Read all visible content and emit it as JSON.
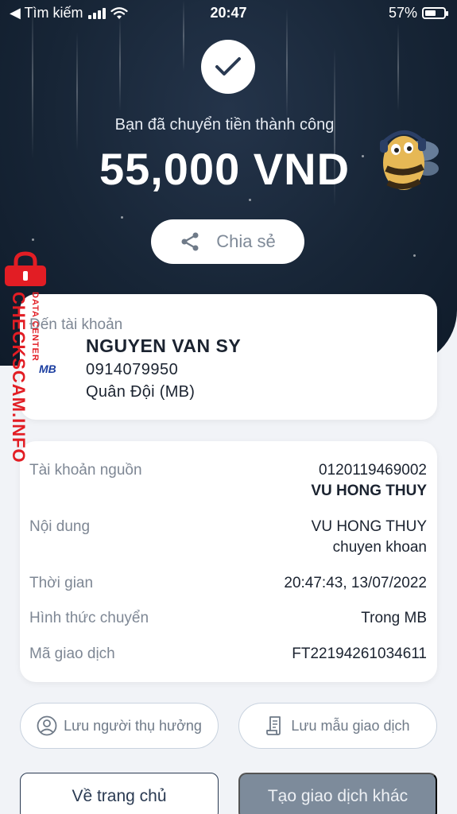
{
  "status_bar": {
    "back_label": "◀ Tìm kiếm",
    "time": "20:47",
    "battery_percent": "57%",
    "battery_level": 0.57
  },
  "success": {
    "message": "Bạn đã chuyển tiền thành công",
    "amount": "55,000 VND"
  },
  "share_button": {
    "label": "Chia sẻ"
  },
  "destination": {
    "label": "Đến tài khoản",
    "bank_logo_text": "MB",
    "name": "NGUYEN VAN SY",
    "account_number": "0914079950",
    "bank_name": "Quân Đội (MB)"
  },
  "details": {
    "source_account": {
      "label": "Tài khoản nguồn",
      "number": "0120119469002",
      "owner": "VU HONG THUY"
    },
    "content": {
      "label": "Nội dung",
      "line1": "VU HONG THUY",
      "line2": "chuyen khoan"
    },
    "time": {
      "label": "Thời gian",
      "value": "20:47:43, 13/07/2022"
    },
    "method": {
      "label": "Hình thức chuyển",
      "value": "Trong MB"
    },
    "transaction_id": {
      "label": "Mã giao dịch",
      "value": "FT22194261034611"
    }
  },
  "actions": {
    "save_recipient": "Lưu người thụ hưởng",
    "save_template": "Lưu mẫu giao dịch",
    "home": "Về trang chủ",
    "new_transaction": "Tạo giao dịch khác"
  },
  "watermark": {
    "main_text": "CHECKSCAM.INFO",
    "sub_text": "DATA CENTER"
  },
  "colors": {
    "hero_bg": "#172536",
    "accent_red": "#e21d24",
    "primary_dark": "#2a3a52",
    "disabled_button": "#7d8b9b"
  }
}
